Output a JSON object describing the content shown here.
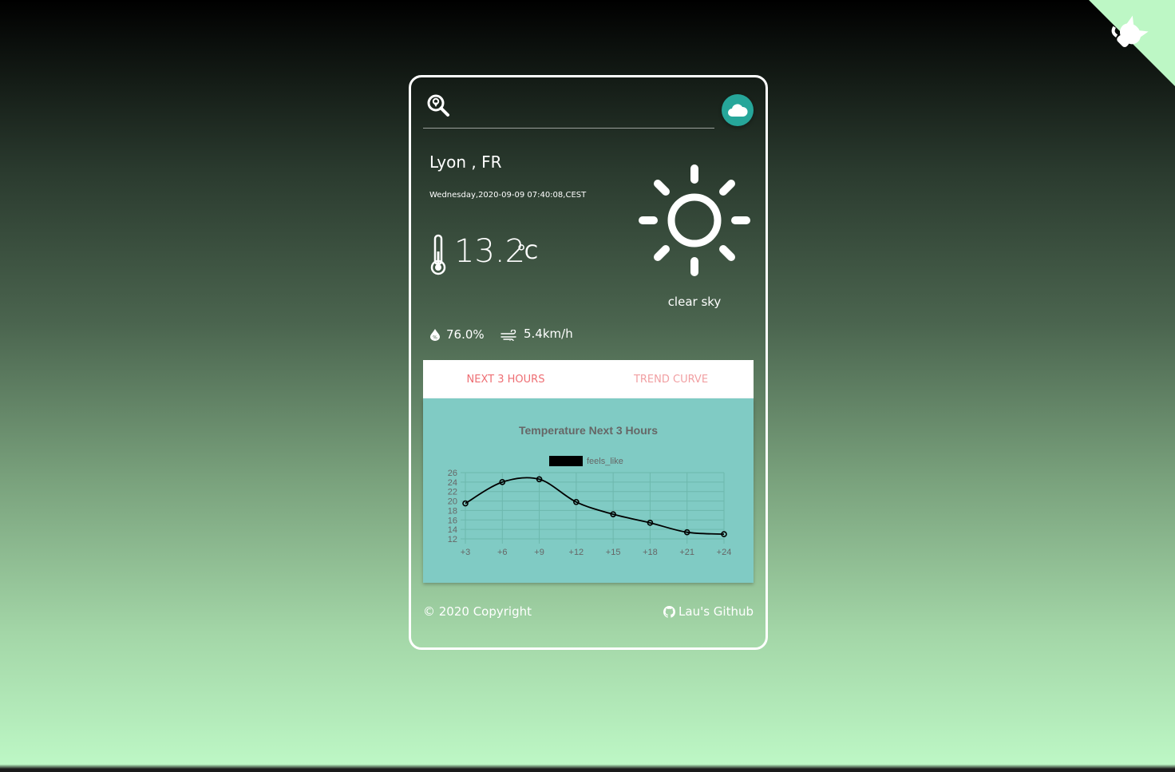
{
  "search": {
    "placeholder": ""
  },
  "location": {
    "city": "Lyon , FR",
    "datetime": "Wednesday,2020-09-09 07:40:08,CEST"
  },
  "current": {
    "temperature": "13.2",
    "unit": "℃",
    "condition": "clear sky",
    "humidity": "76.0%",
    "wind": "5.4km/h"
  },
  "icons": {
    "search": "search-location-icon",
    "weather_button": "cloud-icon",
    "weather": "sun-icon",
    "thermometer": "thermometer-icon",
    "humidity": "humidity-drop-icon",
    "wind": "wind-icon",
    "github": "github-icon",
    "corner": "github-octocat-icon"
  },
  "tabs": [
    {
      "label": "Next 3 hours"
    },
    {
      "label": "Trend curve"
    }
  ],
  "chart_data": {
    "type": "line",
    "title": "Temperature Next 3 Hours",
    "xlabel": "",
    "ylabel": "",
    "x": [
      "+3",
      "+6",
      "+9",
      "+12",
      "+15",
      "+18",
      "+21",
      "+24"
    ],
    "series": [
      {
        "name": "feels_like",
        "values": [
          19.5,
          24.0,
          24.6,
          19.8,
          17.2,
          15.4,
          13.4,
          13.0
        ]
      }
    ],
    "yticks": [
      12,
      14,
      16,
      18,
      20,
      22,
      24,
      26
    ],
    "ylim": [
      12,
      26
    ],
    "grid": true,
    "legend": "top-center",
    "colors": {
      "line": "#000000",
      "grid": "#6db8ad",
      "background": "#80cbc4",
      "text": "#666666"
    }
  },
  "footer": {
    "copyright": "© 2020 Copyright",
    "github_link": "Lau's Github"
  },
  "colors": {
    "accent": "#26a69a",
    "tab_text": "#ee6e73",
    "chart_bg": "#80cbc4",
    "corner_fill": "#bdf7c5"
  }
}
